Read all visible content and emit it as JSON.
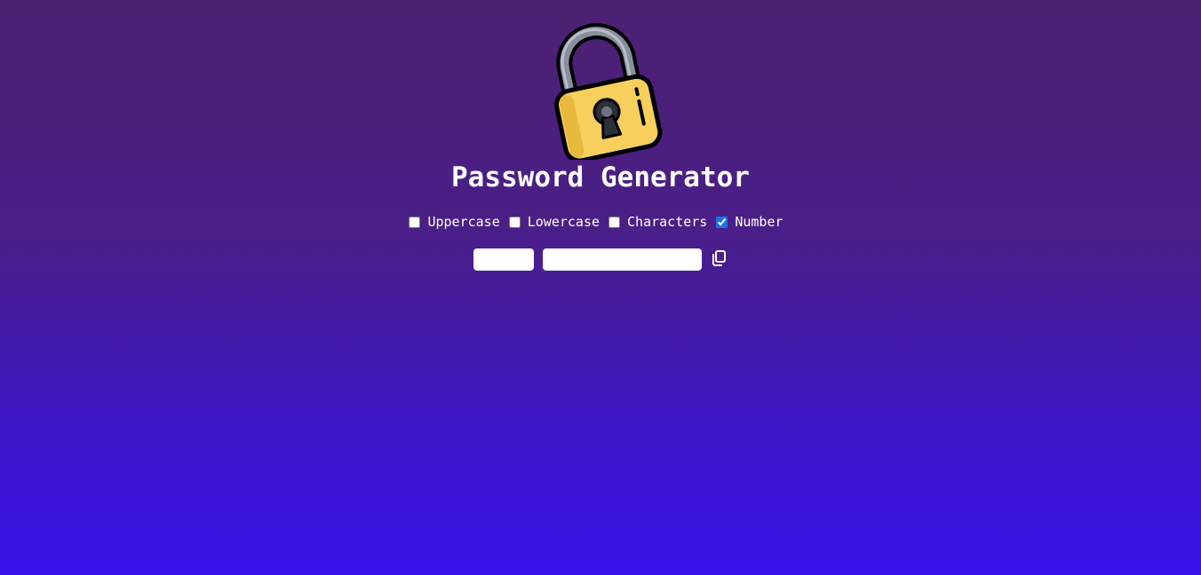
{
  "header": {
    "title": "Password Generator",
    "logo_icon": "padlock-icon"
  },
  "options": [
    {
      "label": "Uppercase",
      "checked": false
    },
    {
      "label": "Lowercase",
      "checked": false
    },
    {
      "label": "Characters",
      "checked": false
    },
    {
      "label": "Number",
      "checked": true
    }
  ],
  "controls": {
    "generate_label": "",
    "password_value": "",
    "password_placeholder": "",
    "copy_icon": "copy-icon"
  },
  "colors": {
    "background_top": "#4c2070",
    "background_bottom": "#3a12ea",
    "lock_body": "#f7cf5c",
    "lock_shackle": "#8a8f9f",
    "text": "#ffffff",
    "checkbox_accent": "#1a73e8"
  }
}
